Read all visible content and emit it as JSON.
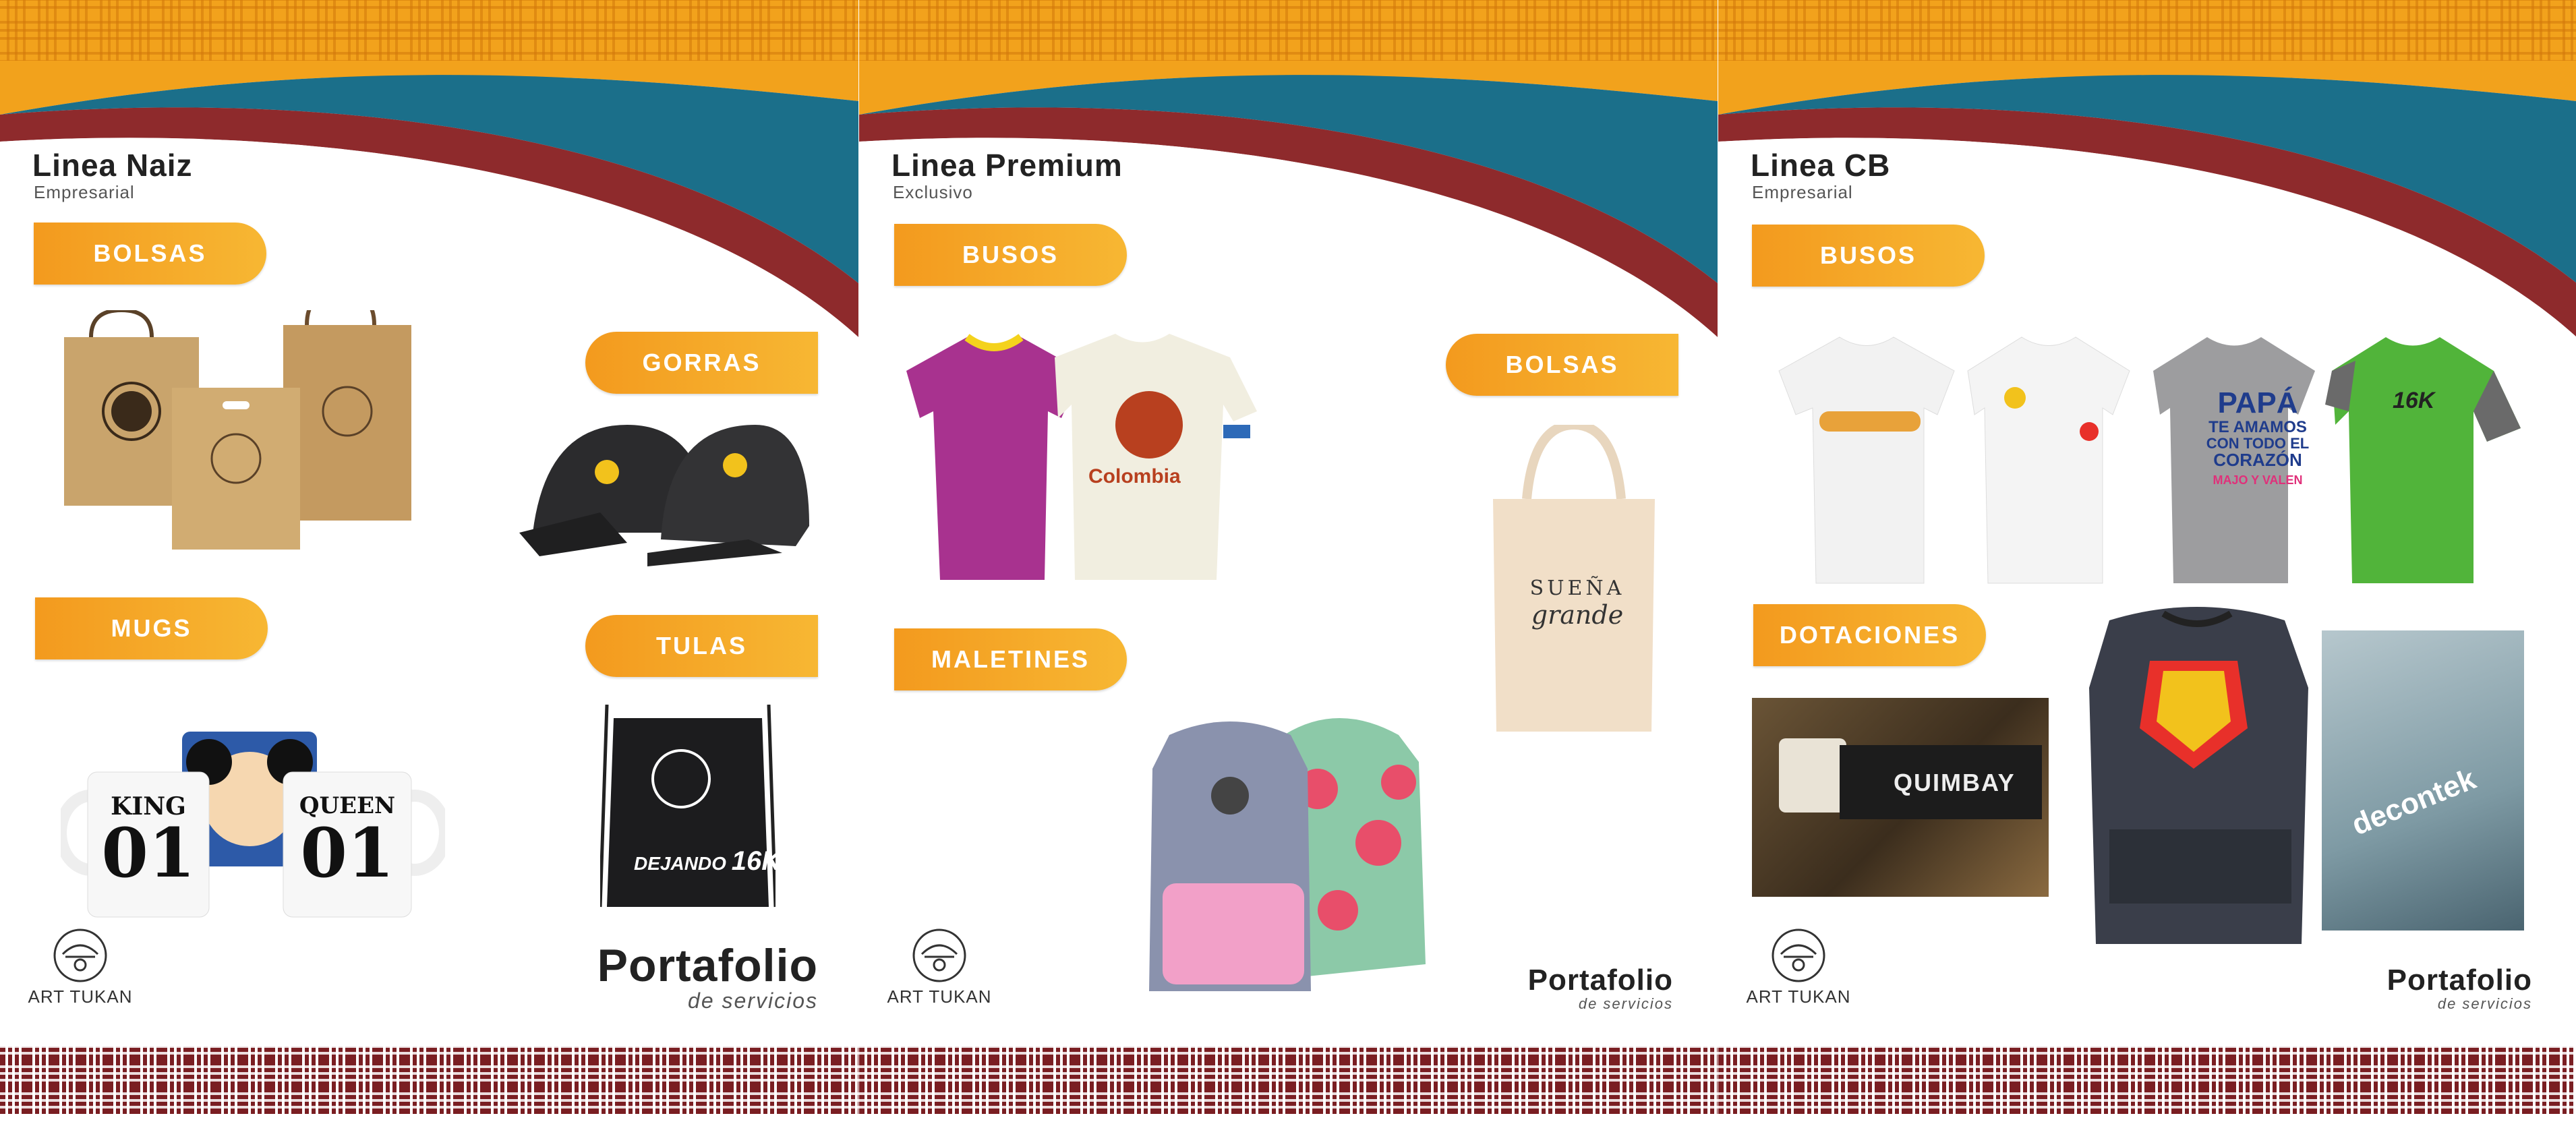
{
  "panels": [
    {
      "title": "Linea Naiz",
      "subtitle": "Empresarial",
      "pills": {
        "bolsas": "BOLSAS",
        "gorras": "GORRAS",
        "mugs": "MUGS",
        "tulas": "TULAS"
      },
      "product_text": {
        "mug_left_1": "KING",
        "mug_left_2": "01",
        "mug_right_1": "QUEEN",
        "mug_right_2": "01",
        "tula_print": "DEJANDO",
        "tula_num": "16K"
      },
      "logo_text": "ART TUKAN",
      "portfolio": {
        "big": "Portafolio",
        "small": "de servicios"
      }
    },
    {
      "title": "Linea Premium",
      "subtitle": "Exclusivo",
      "pills": {
        "busos": "BUSOS",
        "bolsas": "BOLSAS",
        "maletines": "MALETINES"
      },
      "product_text": {
        "shirt_print": "Colombia",
        "bag_line1": "SUEÑA",
        "bag_line2": "grande"
      },
      "logo_text": "ART TUKAN",
      "portfolio": {
        "big": "Portafolio",
        "small": "de servicios"
      }
    },
    {
      "title": "Linea CB",
      "subtitle": "Empresarial",
      "pills": {
        "busos": "BUSOS",
        "dotaciones": "DOTACIONES"
      },
      "product_text": {
        "shirt3_l1": "PAPÁ",
        "shirt3_l2": "TE AMAMOS",
        "shirt3_l3": "CON TODO EL",
        "shirt3_l4": "CORAZÓN",
        "shirt3_l5": "MAJO Y VALEN",
        "shirt4": "16K",
        "polo_brand": "decontek",
        "photo_brand": "QUIMBAY"
      },
      "logo_text": "ART TUKAN",
      "portfolio": {
        "big": "Portafolio",
        "small": "de servicios"
      }
    }
  ],
  "colors": {
    "orange": "#f39a1e",
    "teal": "#1b6f8a",
    "maroon": "#8e2a2c",
    "band_red": "#7a1e22"
  }
}
